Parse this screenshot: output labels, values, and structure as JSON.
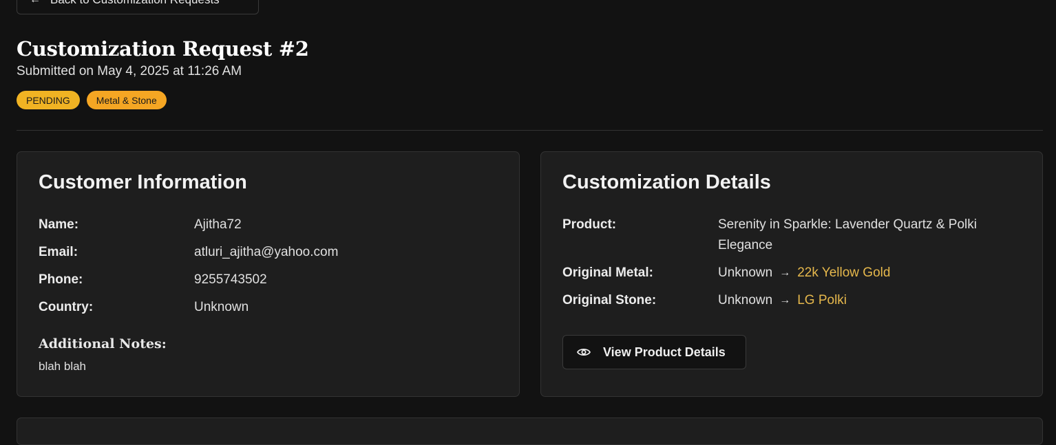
{
  "back_button": {
    "label": "Back to Customization Requests",
    "icon": "arrow-left-icon"
  },
  "header": {
    "title": "Customization Request #2",
    "submitted": "Submitted on May 4, 2025 at 11:26 AM"
  },
  "badges": {
    "status": "PENDING",
    "type": "Metal & Stone"
  },
  "customer": {
    "title": "Customer Information",
    "rows": [
      {
        "label": "Name:",
        "value": "Ajitha72"
      },
      {
        "label": "Email:",
        "value": "atluri_ajitha@yahoo.com"
      },
      {
        "label": "Phone:",
        "value": "9255743502"
      },
      {
        "label": "Country:",
        "value": "Unknown"
      }
    ],
    "notes_title": "Additional Notes:",
    "notes": "blah blah"
  },
  "details": {
    "title": "Customization Details",
    "product_label": "Product:",
    "product_value": "Serenity in Sparkle: Lavender Quartz & Polki Elegance",
    "metal_label": "Original Metal:",
    "metal_original": "Unknown",
    "metal_new": "22k Yellow Gold",
    "stone_label": "Original Stone:",
    "stone_original": "Unknown",
    "stone_new": "LG Polki",
    "view_button": "View Product Details",
    "view_icon": "eye-icon"
  },
  "colors": {
    "background": "#121212",
    "card": "#1e1e1e",
    "accent": "#e6b84c",
    "badge_pending": "#f0b323",
    "badge_type": "#f5a623"
  }
}
